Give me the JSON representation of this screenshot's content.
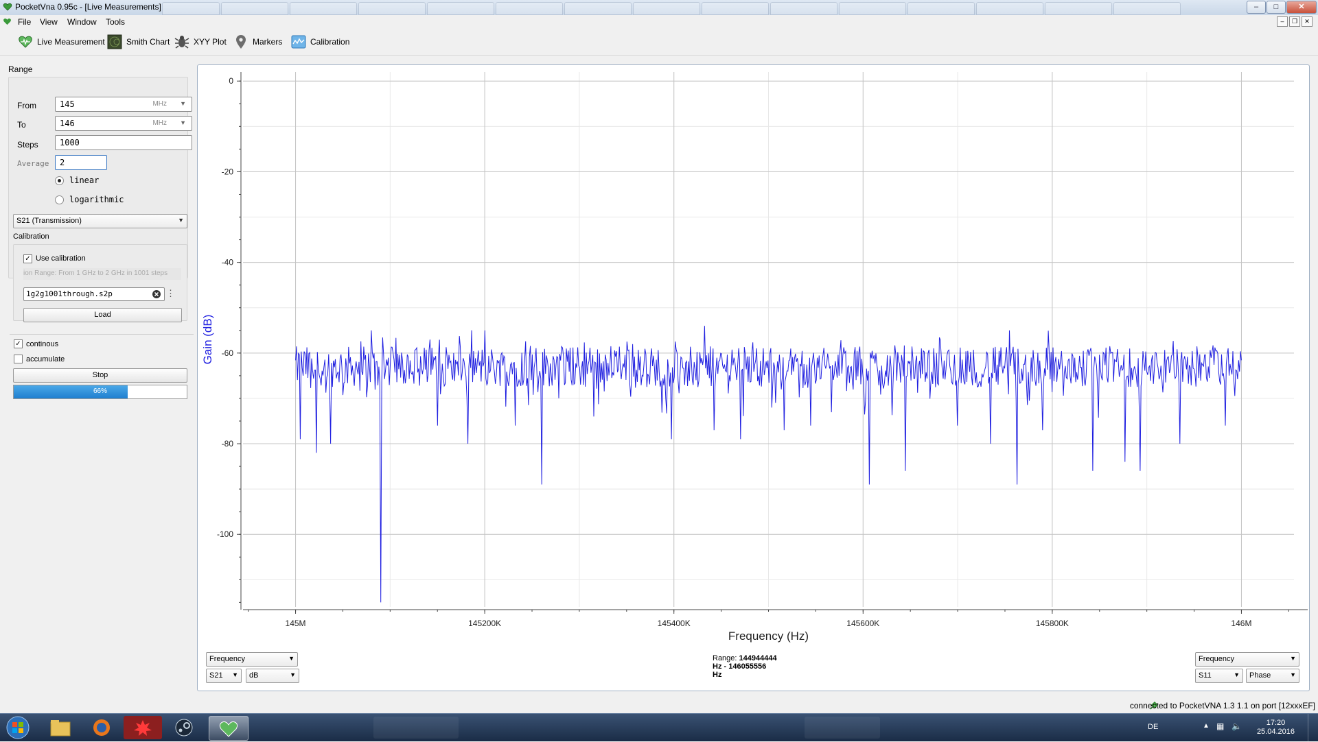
{
  "window": {
    "title": "PocketVna 0.95c - [Live Measurements]"
  },
  "menu": {
    "items": [
      "File",
      "View",
      "Window",
      "Tools"
    ]
  },
  "toolbar": {
    "items": [
      {
        "label": "Live Measurement",
        "icon": "heart-monitor-icon"
      },
      {
        "label": "Smith Chart",
        "icon": "smith-chart-icon"
      },
      {
        "label": "XYY Plot",
        "icon": "bug-icon"
      },
      {
        "label": "Markers",
        "icon": "map-pin-icon"
      },
      {
        "label": "Calibration",
        "icon": "calibration-icon"
      }
    ]
  },
  "range": {
    "title": "Range",
    "from_label": "From",
    "from_value": "145",
    "from_unit": "MHz",
    "to_label": "To",
    "to_value": "146",
    "to_unit": "MHz",
    "steps_label": "Steps",
    "steps_value": "1000",
    "average_label": "Average",
    "average_value": "2",
    "scale_options": [
      {
        "label": "linear",
        "selected": true
      },
      {
        "label": "logarithmic",
        "selected": false
      }
    ]
  },
  "measurement_select": {
    "value": "S21 (Transmission)"
  },
  "calibration": {
    "title": "Calibration",
    "use_label": "Use calibration",
    "use_checked": true,
    "info": "ion Range: From 1 GHz to 2 GHz in 1001 steps",
    "file": "1g2g1001through.s2p",
    "load_label": "Load"
  },
  "options": {
    "continous_label": "continous",
    "continous_checked": true,
    "accumulate_label": "accumulate",
    "accumulate_checked": false
  },
  "stop_label": "Stop",
  "progress": {
    "value": 0.66,
    "text": "66%"
  },
  "chart_data": {
    "type": "line",
    "xlabel": "Frequency (Hz)",
    "ylabel": "Gain (dB)",
    "xlim": [
      144944444,
      146055556
    ],
    "ylim": [
      -116,
      2
    ],
    "x_ticks": [
      145000000,
      145200000,
      145400000,
      145600000,
      145800000,
      146000000
    ],
    "x_tick_labels": [
      "145M",
      "145200K",
      "145400K",
      "145600K",
      "145800K",
      "146M"
    ],
    "y_ticks": [
      0,
      -20,
      -40,
      -60,
      -80,
      -100
    ],
    "y_tick_labels": [
      "0",
      "-20",
      "-40",
      "-60",
      "-80",
      "-100"
    ],
    "grid": true,
    "line_color": "#2020e0",
    "series": [
      {
        "x_start": 145000000,
        "x_end": 146000000,
        "points": 1000,
        "mean": -63,
        "spread": 4.5,
        "dips": [
          {
            "x": 145005000,
            "y": -79
          },
          {
            "x": 145022000,
            "y": -82
          },
          {
            "x": 145037000,
            "y": -80
          },
          {
            "x": 145090000,
            "y": -115
          },
          {
            "x": 145150000,
            "y": -76
          },
          {
            "x": 145182000,
            "y": -80
          },
          {
            "x": 145232000,
            "y": -76
          },
          {
            "x": 145260000,
            "y": -89
          },
          {
            "x": 145315000,
            "y": -74
          },
          {
            "x": 145397000,
            "y": -79
          },
          {
            "x": 145442000,
            "y": -77
          },
          {
            "x": 145470000,
            "y": -79
          },
          {
            "x": 145517000,
            "y": -77
          },
          {
            "x": 145545000,
            "y": -76
          },
          {
            "x": 145607000,
            "y": -89
          },
          {
            "x": 145645000,
            "y": -86
          },
          {
            "x": 145700000,
            "y": -76
          },
          {
            "x": 145735000,
            "y": -80
          },
          {
            "x": 145763000,
            "y": -89
          },
          {
            "x": 145790000,
            "y": -77
          },
          {
            "x": 145843000,
            "y": -86
          },
          {
            "x": 145877000,
            "y": -84
          },
          {
            "x": 145893000,
            "y": -86
          },
          {
            "x": 145935000,
            "y": -80
          },
          {
            "x": 145983000,
            "y": -76
          }
        ],
        "peaks": [
          {
            "x": 145432000,
            "y": -54
          },
          {
            "x": 145080000,
            "y": -55
          },
          {
            "x": 145755000,
            "y": -55
          },
          {
            "x": 145200000,
            "y": -55
          }
        ]
      }
    ]
  },
  "bottom": {
    "left_x_axis": "Frequency",
    "left_param": "S21",
    "left_unit": "dB",
    "range_label": "Range:",
    "range_from": "144944444",
    "range_line2": "Hz - 146055556",
    "range_line3": "Hz",
    "right_x_axis": "Frequency",
    "right_param": "S11",
    "right_unit": "Phase"
  },
  "status": {
    "text": "connected to PocketVNA 1.3 1.1 on port [12xxxEF]"
  },
  "taskbar": {
    "lang": "DE",
    "time": "17:20",
    "date": "25.04.2016",
    "apps": [
      "windows-start-icon",
      "file-explorer-icon",
      "firefox-icon",
      "red-app-icon",
      "steam-icon",
      "pocketvna-icon"
    ]
  }
}
